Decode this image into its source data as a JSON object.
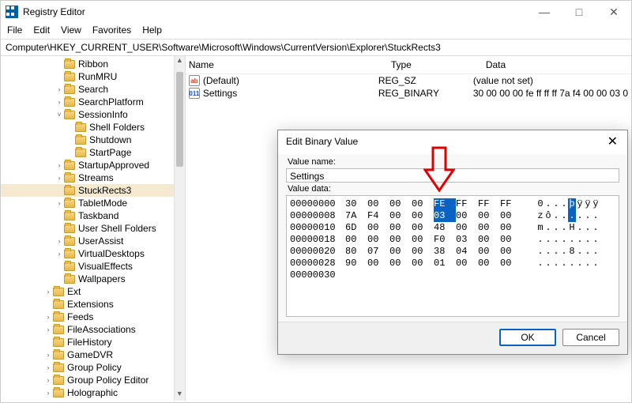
{
  "window": {
    "title": "Registry Editor",
    "controls": {
      "min": "—",
      "max": "□",
      "close": "✕"
    }
  },
  "menu": [
    "File",
    "Edit",
    "View",
    "Favorites",
    "Help"
  ],
  "address": "Computer\\HKEY_CURRENT_USER\\Software\\Microsoft\\Windows\\CurrentVersion\\Explorer\\StuckRects3",
  "tree": [
    {
      "indent": 68,
      "chev": "",
      "label": "Ribbon"
    },
    {
      "indent": 68,
      "chev": "",
      "label": "RunMRU"
    },
    {
      "indent": 68,
      "chev": ">",
      "label": "Search"
    },
    {
      "indent": 68,
      "chev": ">",
      "label": "SearchPlatform"
    },
    {
      "indent": 68,
      "chev": "v",
      "label": "SessionInfo"
    },
    {
      "indent": 82,
      "chev": "",
      "label": "Shell Folders"
    },
    {
      "indent": 82,
      "chev": "",
      "label": "Shutdown"
    },
    {
      "indent": 82,
      "chev": "",
      "label": "StartPage"
    },
    {
      "indent": 68,
      "chev": ">",
      "label": "StartupApproved"
    },
    {
      "indent": 68,
      "chev": ">",
      "label": "Streams"
    },
    {
      "indent": 68,
      "chev": "",
      "label": "StuckRects3",
      "selected": true
    },
    {
      "indent": 68,
      "chev": ">",
      "label": "TabletMode"
    },
    {
      "indent": 68,
      "chev": "",
      "label": "Taskband"
    },
    {
      "indent": 68,
      "chev": "",
      "label": "User Shell Folders"
    },
    {
      "indent": 68,
      "chev": ">",
      "label": "UserAssist"
    },
    {
      "indent": 68,
      "chev": ">",
      "label": "VirtualDesktops"
    },
    {
      "indent": 68,
      "chev": "",
      "label": "VisualEffects"
    },
    {
      "indent": 68,
      "chev": "",
      "label": "Wallpapers"
    },
    {
      "indent": 54,
      "chev": ">",
      "label": "Ext"
    },
    {
      "indent": 54,
      "chev": "",
      "label": "Extensions"
    },
    {
      "indent": 54,
      "chev": ">",
      "label": "Feeds"
    },
    {
      "indent": 54,
      "chev": ">",
      "label": "FileAssociations"
    },
    {
      "indent": 54,
      "chev": "",
      "label": "FileHistory"
    },
    {
      "indent": 54,
      "chev": ">",
      "label": "GameDVR"
    },
    {
      "indent": 54,
      "chev": ">",
      "label": "Group Policy"
    },
    {
      "indent": 54,
      "chev": ">",
      "label": "Group Policy Editor"
    },
    {
      "indent": 54,
      "chev": ">",
      "label": "Holographic"
    }
  ],
  "list": {
    "headers": {
      "name": "Name",
      "type": "Type",
      "data": "Data"
    },
    "rows": [
      {
        "icon": "str",
        "icon_text": "ab",
        "name": "(Default)",
        "type": "REG_SZ",
        "data": "(value not set)"
      },
      {
        "icon": "bin",
        "icon_text": "011",
        "name": "Settings",
        "type": "REG_BINARY",
        "data": "30 00 00 00 fe ff ff ff 7a f4 00 00 03 0"
      }
    ]
  },
  "dialog": {
    "title": "Edit Binary Value",
    "close": "✕",
    "name_label": "Value name:",
    "name_value": "Settings",
    "data_label": "Value data:",
    "hex": [
      {
        "off": "00000000",
        "b": [
          "30",
          "00",
          "00",
          "00",
          "FE",
          "FF",
          "FF",
          "FF"
        ],
        "sel": [
          4
        ],
        "a": [
          "0",
          ".",
          ".",
          ".",
          "þ",
          "ÿ",
          "ÿ",
          "ÿ"
        ],
        "asel": [
          4
        ]
      },
      {
        "off": "00000008",
        "b": [
          "7A",
          "F4",
          "00",
          "00",
          "03",
          "00",
          "00",
          "00"
        ],
        "sel": [
          4
        ],
        "a": [
          "z",
          "ô",
          ".",
          ".",
          ".",
          ".",
          ".",
          "."
        ],
        "asel": [
          4
        ]
      },
      {
        "off": "00000010",
        "b": [
          "6D",
          "00",
          "00",
          "00",
          "48",
          "00",
          "00",
          "00"
        ],
        "sel": [],
        "a": [
          "m",
          ".",
          ".",
          ".",
          "H",
          ".",
          ".",
          "."
        ],
        "asel": []
      },
      {
        "off": "00000018",
        "b": [
          "00",
          "00",
          "00",
          "00",
          "F0",
          "03",
          "00",
          "00"
        ],
        "sel": [],
        "a": [
          ".",
          ".",
          ".",
          ".",
          ".",
          ".",
          ".",
          "."
        ],
        "asel": []
      },
      {
        "off": "00000020",
        "b": [
          "80",
          "07",
          "00",
          "00",
          "38",
          "04",
          "00",
          "00"
        ],
        "sel": [],
        "a": [
          ".",
          ".",
          ".",
          ".",
          "8",
          ".",
          ".",
          "."
        ],
        "asel": []
      },
      {
        "off": "00000028",
        "b": [
          "90",
          "00",
          "00",
          "00",
          "01",
          "00",
          "00",
          "00"
        ],
        "sel": [],
        "a": [
          ".",
          ".",
          ".",
          ".",
          ".",
          ".",
          ".",
          "."
        ],
        "asel": []
      },
      {
        "off": "00000030",
        "b": [
          "",
          "",
          "",
          "",
          "",
          "",
          "",
          ""
        ],
        "sel": [],
        "a": [
          "",
          "",
          "",
          "",
          "",
          "",
          "",
          ""
        ],
        "asel": []
      }
    ],
    "ok": "OK",
    "cancel": "Cancel"
  }
}
